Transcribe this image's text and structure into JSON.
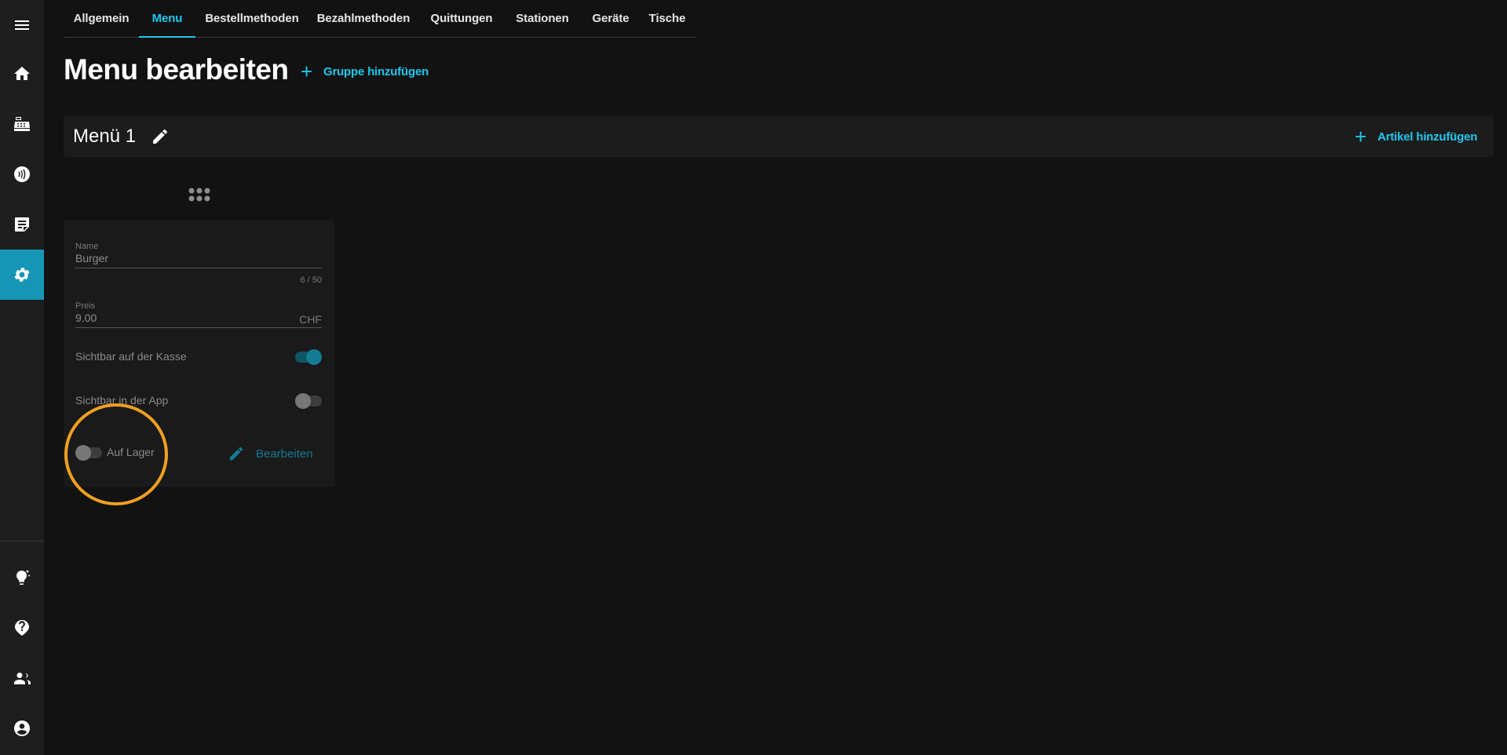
{
  "sidebar": {
    "items": [
      {
        "icon": "menu-icon"
      },
      {
        "icon": "home-icon"
      },
      {
        "icon": "cash-register-icon"
      },
      {
        "icon": "contactless-icon"
      },
      {
        "icon": "receipt-icon"
      },
      {
        "icon": "settings-icon",
        "active": true
      },
      {
        "icon": "lightbulb-icon"
      },
      {
        "icon": "help-icon"
      },
      {
        "icon": "users-icon"
      },
      {
        "icon": "account-icon"
      }
    ]
  },
  "tabs": [
    {
      "label": "Allgemein"
    },
    {
      "label": "Menu",
      "active": true
    },
    {
      "label": "Bestellmethoden"
    },
    {
      "label": "Bezahlmethoden"
    },
    {
      "label": "Quittungen"
    },
    {
      "label": "Stationen"
    },
    {
      "label": "Geräte"
    },
    {
      "label": "Tische"
    }
  ],
  "page": {
    "title": "Menu bearbeiten",
    "add_group": "Gruppe hinzufügen"
  },
  "group": {
    "title": "Menü 1",
    "add_article": "Artikel hinzufügen"
  },
  "article": {
    "name_label": "Name",
    "name_value": "Burger",
    "name_counter": "6 / 50",
    "price_label": "Preis",
    "price_value": "9.00",
    "price_suffix": "CHF",
    "visible_pos_label": "Sichtbar auf der Kasse",
    "visible_pos": true,
    "visible_app_label": "Sichtbar in der App",
    "visible_app": false,
    "in_stock_label": "Auf Lager",
    "in_stock": false,
    "edit_label": "Bearbeiten"
  },
  "colors": {
    "accent": "#1fc8ef",
    "active_nav": "#1596b5",
    "highlight": "#f0a020"
  }
}
